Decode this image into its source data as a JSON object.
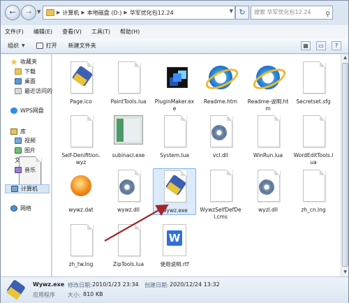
{
  "address": {
    "breadcrumbs": [
      "计算机",
      "本地磁盘 (D:)",
      "华军优化包12.24"
    ]
  },
  "search": {
    "placeholder": "搜索 华军优化包12.24"
  },
  "menu": [
    "文件(F)",
    "编辑(E)",
    "查看(V)",
    "工具(T)",
    "帮助(H)"
  ],
  "toolbar": {
    "organize": "组织",
    "open": "打开",
    "new_folder": "新建文件夹"
  },
  "nav": {
    "favorites": "收藏夹",
    "downloads": "下载",
    "desktop": "桌面",
    "recent": "最近访问的",
    "wps": "WPS网盘",
    "library": "库",
    "videos": "视频",
    "pictures": "图片",
    "documents": "文档",
    "music": "音乐",
    "computer": "计算机",
    "network": "网络"
  },
  "files": [
    {
      "name": "Page.ico",
      "icon": "broom-icon"
    },
    {
      "name": "PaintTools.lua",
      "icon": "blank-file-icon"
    },
    {
      "name": "PluginMaker.exe",
      "icon": "pluginmaker-icon"
    },
    {
      "name": "Readme.htm",
      "icon": "ie-icon"
    },
    {
      "name": "Readme-说明.htm",
      "icon": "ie-icon"
    },
    {
      "name": "Secretset.sfg",
      "icon": "blank-file-icon"
    },
    {
      "name": "Self-Denifition.wyz",
      "icon": "blank-file-icon"
    },
    {
      "name": "subinacl.exe",
      "icon": "screenshot-icon"
    },
    {
      "name": "System.lua",
      "icon": "blank-file-icon"
    },
    {
      "name": "vcl.dll",
      "icon": "gear-file-icon"
    },
    {
      "name": "WinRun.lua",
      "icon": "blank-file-icon"
    },
    {
      "name": "WordEditTools.lua",
      "icon": "blank-file-icon"
    },
    {
      "name": "wywz.dat",
      "icon": "orb-icon"
    },
    {
      "name": "wywz.dll",
      "icon": "gear-file-icon"
    },
    {
      "name": "Wywz.exe",
      "icon": "broom-icon",
      "selected": true
    },
    {
      "name": "WywzSelfDefDel.cms",
      "icon": "blank-file-icon"
    },
    {
      "name": "wyzl.dll",
      "icon": "gear-file-icon"
    },
    {
      "name": "zh_cn.lng",
      "icon": "blank-file-icon"
    },
    {
      "name": "zh_tw.lng",
      "icon": "blank-file-icon"
    },
    {
      "name": "ZipTools.lua",
      "icon": "blank-file-icon"
    },
    {
      "name": "使用说明.rtf",
      "icon": "wps-icon"
    }
  ],
  "status": {
    "name": "Wywz.exe",
    "modified_label": "修改日期:",
    "modified": "2010/1/23 23:34",
    "created_label": "创建日期:",
    "created": "2020/12/24 13:32",
    "type": "应用程序",
    "size_label": "大小:",
    "size": "810 KB"
  }
}
